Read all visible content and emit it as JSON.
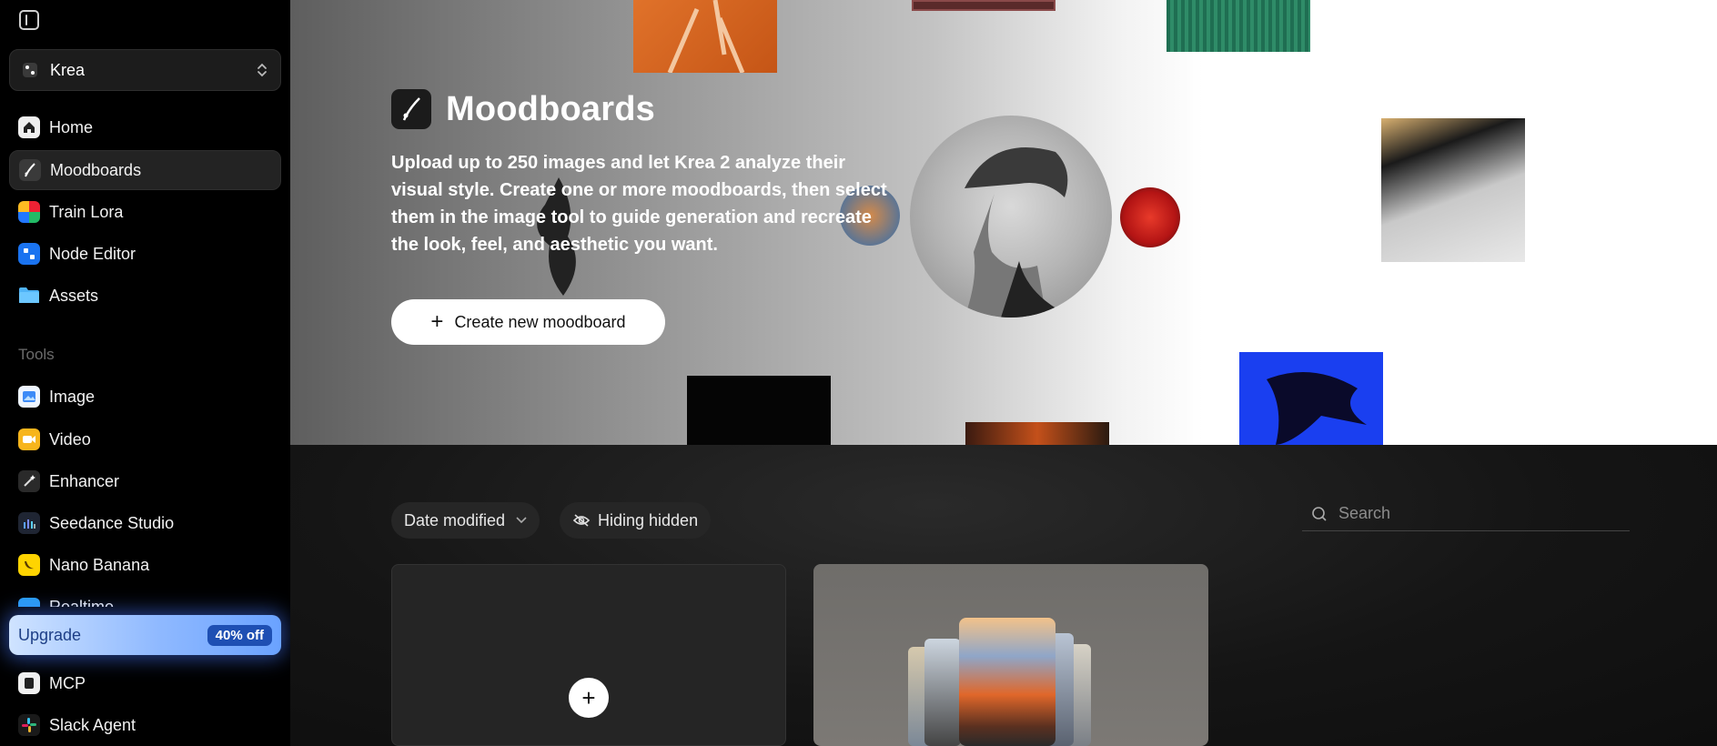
{
  "sidebar": {
    "workspace": {
      "name": "Krea"
    },
    "nav": [
      {
        "label": "Home",
        "icon": "home-icon",
        "active": false
      },
      {
        "label": "Moodboards",
        "icon": "moodboards-icon",
        "active": true
      },
      {
        "label": "Train Lora",
        "icon": "train-lora-icon",
        "active": false
      },
      {
        "label": "Node Editor",
        "icon": "node-editor-icon",
        "active": false
      },
      {
        "label": "Assets",
        "icon": "folder-icon",
        "active": false
      }
    ],
    "tools_label": "Tools",
    "tools": [
      {
        "label": "Image",
        "icon": "image-icon"
      },
      {
        "label": "Video",
        "icon": "video-icon"
      },
      {
        "label": "Enhancer",
        "icon": "enhancer-icon"
      },
      {
        "label": "Seedance Studio",
        "icon": "seedance-icon"
      },
      {
        "label": "Nano Banana",
        "icon": "banana-icon"
      },
      {
        "label": "Realtime",
        "icon": "realtime-icon"
      }
    ],
    "upgrade": {
      "label": "Upgrade",
      "badge": "40% off"
    },
    "bottom": [
      {
        "label": "MCP",
        "icon": "mcp-icon"
      },
      {
        "label": "Slack Agent",
        "icon": "slack-icon"
      }
    ]
  },
  "hero": {
    "title": "Moodboards",
    "description": "Upload up to 250 images and let Krea 2 analyze their visual style. Create one or more moodboards, then select them in the image tool to guide generation and recreate the look, feel, and aesthetic you want.",
    "create_button": "Create new moodboard"
  },
  "toolbar": {
    "sort_label": "Date modified",
    "visibility_label": "Hiding hidden",
    "search_placeholder": "Search"
  },
  "colors": {
    "accent_upgrade": "#8fb9ff",
    "upgrade_badge": "#1e4fb3"
  }
}
